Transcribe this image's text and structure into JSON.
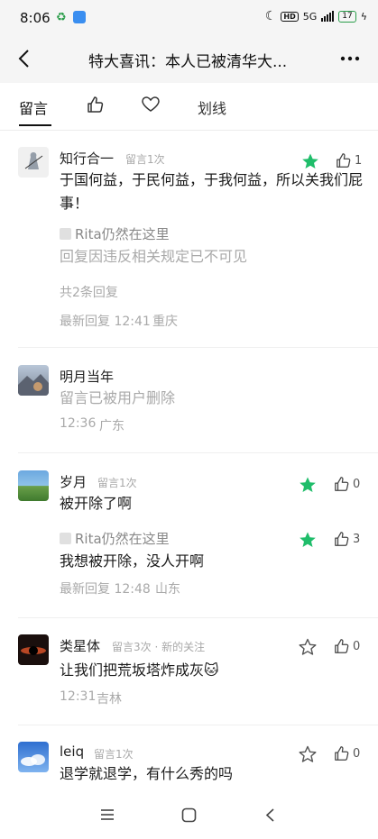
{
  "status_bar": {
    "time": "8:06",
    "signal": "5G",
    "battery": "17"
  },
  "header": {
    "title": "特大喜讯：本人已被清华大..."
  },
  "tabs": [
    {
      "label": "留言"
    },
    {
      "label": "👍"
    },
    {
      "label": "♡"
    },
    {
      "label": "划线"
    }
  ],
  "comments": [
    {
      "name": "知行合一",
      "tag": "留言1次",
      "text": "于国何益，于民何益，于我何益，所以关我们屁事！",
      "like_count": "1",
      "reply_user": "Rita仍然在这里",
      "reply_text": "回复因违反相关规定已不可见",
      "replies_link": "共2条回复",
      "footer": "最新回复 12:41",
      "location": "重庆"
    },
    {
      "name": "明月当年",
      "text": "留言已被用户删除",
      "footer": "12:36",
      "location": "广东"
    },
    {
      "name": "岁月",
      "tag": "留言1次",
      "text": "被开除了啊",
      "like_count": "0",
      "reply_user": "Rita仍然在这里",
      "reply_text": "我想被开除，没人开啊",
      "reply_like_count": "3",
      "footer": "最新回复 12:48",
      "location": "山东"
    },
    {
      "name": "类星体",
      "tag": "留言3次 · 新的关注",
      "text": "让我们把荒坂塔炸成灰🐱",
      "like_count": "0",
      "footer": "12:31",
      "location": "吉林"
    },
    {
      "name": "leiq",
      "tag": "留言1次",
      "text": "退学就退学，有什么秀的吗",
      "like_count": "0"
    }
  ],
  "colors": {
    "accent_star": "#1fbd6a",
    "link": "#4a6ea8"
  }
}
